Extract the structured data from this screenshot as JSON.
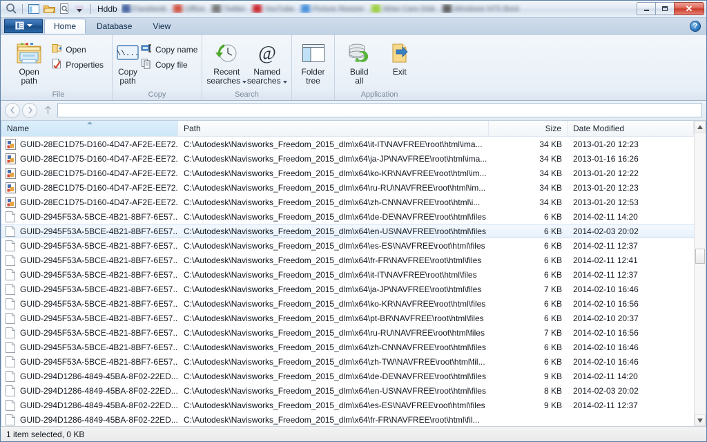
{
  "window": {
    "title": "Hddb",
    "controls": {
      "minimize": "–",
      "maximize": "❐",
      "close": "✕"
    },
    "quick_access": [
      {
        "icon": "search-icon"
      },
      {
        "icon": "panel-layout-icon"
      },
      {
        "icon": "folder-open-icon"
      },
      {
        "icon": "document-search-icon"
      },
      {
        "icon": "dropdown-arrow-icon"
      }
    ],
    "favorites": [
      {
        "label": "Facebook",
        "color": "#3b5998"
      },
      {
        "label": "Office",
        "color": "#d14836"
      },
      {
        "label": "Twitter",
        "color": "#707070"
      },
      {
        "label": "YouTube",
        "color": "#cc181e"
      },
      {
        "label": "Picture Resizer",
        "color": "#3b8ad8"
      },
      {
        "label": "Wise Care Disk",
        "color": "#9acd32"
      },
      {
        "label": "Windows NT5 Boot",
        "color": "#555555"
      }
    ]
  },
  "ribbon": {
    "app_button": {
      "label": "",
      "icon": "application-menu-icon"
    },
    "tabs": [
      {
        "label": "Home",
        "active": true
      },
      {
        "label": "Database",
        "active": false
      },
      {
        "label": "View",
        "active": false
      }
    ],
    "help_label": "?",
    "groups": [
      {
        "name": "File",
        "label": "File",
        "big_buttons": [
          {
            "label": "Open\npath",
            "line1": "Open",
            "line2": "path",
            "icon": "open-path-folder-icon"
          }
        ],
        "small_buttons": [
          {
            "label": "Open",
            "icon": "open-icon"
          },
          {
            "label": "Properties",
            "icon": "properties-icon"
          }
        ]
      },
      {
        "name": "Copy",
        "label": "Copy",
        "big_buttons": [
          {
            "line1": "Copy",
            "line2": "path",
            "icon": "copy-path-icon"
          }
        ],
        "small_buttons": [
          {
            "label": "Copy name",
            "icon": "copy-name-icon"
          },
          {
            "label": "Copy file",
            "icon": "copy-file-icon"
          }
        ]
      },
      {
        "name": "Search",
        "label": "Search",
        "big_buttons": [
          {
            "line1": "Recent",
            "line2": "searches",
            "icon": "recent-searches-clock-icon",
            "has_dropdown": true
          },
          {
            "line1": "Named",
            "line2": "searches",
            "icon": "named-searches-at-icon",
            "has_dropdown": true
          }
        ],
        "small_buttons": []
      },
      {
        "name": "Tree",
        "label": "",
        "big_buttons": [
          {
            "line1": "Folder",
            "line2": "tree",
            "icon": "folder-tree-icon"
          }
        ],
        "small_buttons": []
      },
      {
        "name": "Application",
        "label": "Application",
        "big_buttons": [
          {
            "line1": "Build",
            "line2": "all",
            "icon": "build-all-database-icon"
          },
          {
            "line1": "Exit",
            "line2": "",
            "icon": "exit-icon"
          }
        ],
        "small_buttons": []
      }
    ]
  },
  "navbar": {
    "back_icon": "back-arrow-icon",
    "forward_icon": "forward-arrow-icon",
    "up_icon": "up-arrow-icon",
    "address_value": "",
    "address_placeholder": ""
  },
  "list": {
    "columns": [
      {
        "key": "name",
        "label": "Name",
        "sorted": true,
        "sort_dir": "asc",
        "align": "left"
      },
      {
        "key": "path",
        "label": "Path",
        "sorted": false,
        "align": "left"
      },
      {
        "key": "size",
        "label": "Size",
        "sorted": false,
        "align": "right"
      },
      {
        "key": "date",
        "label": "Date Modified",
        "sorted": false,
        "align": "left"
      }
    ],
    "rows": [
      {
        "icon": "html-file-icon",
        "name": "GUID-28EC1D75-D160-4D47-AF2E-EE72...",
        "path": "C:\\Autodesk\\Navisworks_Freedom_2015_dlm\\x64\\it-IT\\NAVFREE\\root\\html\\ima...",
        "size": "34 KB",
        "date": "2013-01-20 12:23",
        "selected": false
      },
      {
        "icon": "html-file-icon",
        "name": "GUID-28EC1D75-D160-4D47-AF2E-EE72...",
        "path": "C:\\Autodesk\\Navisworks_Freedom_2015_dlm\\x64\\ja-JP\\NAVFREE\\root\\html\\ima...",
        "size": "34 KB",
        "date": "2013-01-16 16:26",
        "selected": false
      },
      {
        "icon": "html-file-icon",
        "name": "GUID-28EC1D75-D160-4D47-AF2E-EE72...",
        "path": "C:\\Autodesk\\Navisworks_Freedom_2015_dlm\\x64\\ko-KR\\NAVFREE\\root\\html\\im...",
        "size": "34 KB",
        "date": "2013-01-20 12:22",
        "selected": false
      },
      {
        "icon": "html-file-icon",
        "name": "GUID-28EC1D75-D160-4D47-AF2E-EE72...",
        "path": "C:\\Autodesk\\Navisworks_Freedom_2015_dlm\\x64\\ru-RU\\NAVFREE\\root\\html\\im...",
        "size": "34 KB",
        "date": "2013-01-20 12:23",
        "selected": false
      },
      {
        "icon": "html-file-icon",
        "name": "GUID-28EC1D75-D160-4D47-AF2E-EE72...",
        "path": "C:\\Autodesk\\Navisworks_Freedom_2015_dlm\\x64\\zh-CN\\NAVFREE\\root\\html\\i...",
        "size": "34 KB",
        "date": "2013-01-20 12:53",
        "selected": false
      },
      {
        "icon": "generic-file-icon",
        "name": "GUID-2945F53A-5BCE-4B21-8BF7-6E57...",
        "path": "C:\\Autodesk\\Navisworks_Freedom_2015_dlm\\x64\\de-DE\\NAVFREE\\root\\html\\files",
        "size": "6 KB",
        "date": "2014-02-11 14:20",
        "selected": false
      },
      {
        "icon": "generic-file-icon",
        "name": "GUID-2945F53A-5BCE-4B21-8BF7-6E57...",
        "path": "C:\\Autodesk\\Navisworks_Freedom_2015_dlm\\x64\\en-US\\NAVFREE\\root\\html\\files",
        "size": "6 KB",
        "date": "2014-02-03 20:02",
        "selected": true
      },
      {
        "icon": "generic-file-icon",
        "name": "GUID-2945F53A-5BCE-4B21-8BF7-6E57...",
        "path": "C:\\Autodesk\\Navisworks_Freedom_2015_dlm\\x64\\es-ES\\NAVFREE\\root\\html\\files",
        "size": "6 KB",
        "date": "2014-02-11 12:37",
        "selected": false
      },
      {
        "icon": "generic-file-icon",
        "name": "GUID-2945F53A-5BCE-4B21-8BF7-6E57...",
        "path": "C:\\Autodesk\\Navisworks_Freedom_2015_dlm\\x64\\fr-FR\\NAVFREE\\root\\html\\files",
        "size": "6 KB",
        "date": "2014-02-11 12:41",
        "selected": false
      },
      {
        "icon": "generic-file-icon",
        "name": "GUID-2945F53A-5BCE-4B21-8BF7-6E57...",
        "path": "C:\\Autodesk\\Navisworks_Freedom_2015_dlm\\x64\\it-IT\\NAVFREE\\root\\html\\files",
        "size": "6 KB",
        "date": "2014-02-11 12:37",
        "selected": false
      },
      {
        "icon": "generic-file-icon",
        "name": "GUID-2945F53A-5BCE-4B21-8BF7-6E57...",
        "path": "C:\\Autodesk\\Navisworks_Freedom_2015_dlm\\x64\\ja-JP\\NAVFREE\\root\\html\\files",
        "size": "7 KB",
        "date": "2014-02-10 16:46",
        "selected": false
      },
      {
        "icon": "generic-file-icon",
        "name": "GUID-2945F53A-5BCE-4B21-8BF7-6E57...",
        "path": "C:\\Autodesk\\Navisworks_Freedom_2015_dlm\\x64\\ko-KR\\NAVFREE\\root\\html\\files",
        "size": "6 KB",
        "date": "2014-02-10 16:56",
        "selected": false
      },
      {
        "icon": "generic-file-icon",
        "name": "GUID-2945F53A-5BCE-4B21-8BF7-6E57...",
        "path": "C:\\Autodesk\\Navisworks_Freedom_2015_dlm\\x64\\pt-BR\\NAVFREE\\root\\html\\files",
        "size": "6 KB",
        "date": "2014-02-10 20:37",
        "selected": false
      },
      {
        "icon": "generic-file-icon",
        "name": "GUID-2945F53A-5BCE-4B21-8BF7-6E57...",
        "path": "C:\\Autodesk\\Navisworks_Freedom_2015_dlm\\x64\\ru-RU\\NAVFREE\\root\\html\\files",
        "size": "7 KB",
        "date": "2014-02-10 16:56",
        "selected": false
      },
      {
        "icon": "generic-file-icon",
        "name": "GUID-2945F53A-5BCE-4B21-8BF7-6E57...",
        "path": "C:\\Autodesk\\Navisworks_Freedom_2015_dlm\\x64\\zh-CN\\NAVFREE\\root\\html\\files",
        "size": "6 KB",
        "date": "2014-02-10 16:46",
        "selected": false
      },
      {
        "icon": "generic-file-icon",
        "name": "GUID-2945F53A-5BCE-4B21-8BF7-6E57...",
        "path": "C:\\Autodesk\\Navisworks_Freedom_2015_dlm\\x64\\zh-TW\\NAVFREE\\root\\html\\fil...",
        "size": "6 KB",
        "date": "2014-02-10 16:46",
        "selected": false
      },
      {
        "icon": "generic-file-icon",
        "name": "GUID-294D1286-4849-45BA-8F02-22ED...",
        "path": "C:\\Autodesk\\Navisworks_Freedom_2015_dlm\\x64\\de-DE\\NAVFREE\\root\\html\\files",
        "size": "9 KB",
        "date": "2014-02-11 14:20",
        "selected": false
      },
      {
        "icon": "generic-file-icon",
        "name": "GUID-294D1286-4849-45BA-8F02-22ED...",
        "path": "C:\\Autodesk\\Navisworks_Freedom_2015_dlm\\x64\\en-US\\NAVFREE\\root\\html\\files",
        "size": "8 KB",
        "date": "2014-02-03 20:02",
        "selected": false
      },
      {
        "icon": "generic-file-icon",
        "name": "GUID-294D1286-4849-45BA-8F02-22ED...",
        "path": "C:\\Autodesk\\Navisworks_Freedom_2015_dlm\\x64\\es-ES\\NAVFREE\\root\\html\\files",
        "size": "9 KB",
        "date": "2014-02-11 12:37",
        "selected": false
      },
      {
        "icon": "generic-file-icon",
        "name": "GUID-294D1286-4849-45BA-8F02-22ED...",
        "path": "C:\\Autodesk\\Navisworks_Freedom_2015_dlm\\x64\\fr-FR\\NAVFREE\\root\\html\\fil...",
        "size": "",
        "date": "",
        "selected": false
      }
    ]
  },
  "statusbar": {
    "text": "1 item selected, 0 KB"
  },
  "scrollbar": {
    "up_icon": "scroll-up-icon",
    "down_icon": "scroll-down-icon"
  },
  "colors": {
    "accent": "#2c6aab",
    "selection": "#e8f2fb",
    "close_red": "#c93c2b",
    "sort_header": "#cfe7f8"
  }
}
